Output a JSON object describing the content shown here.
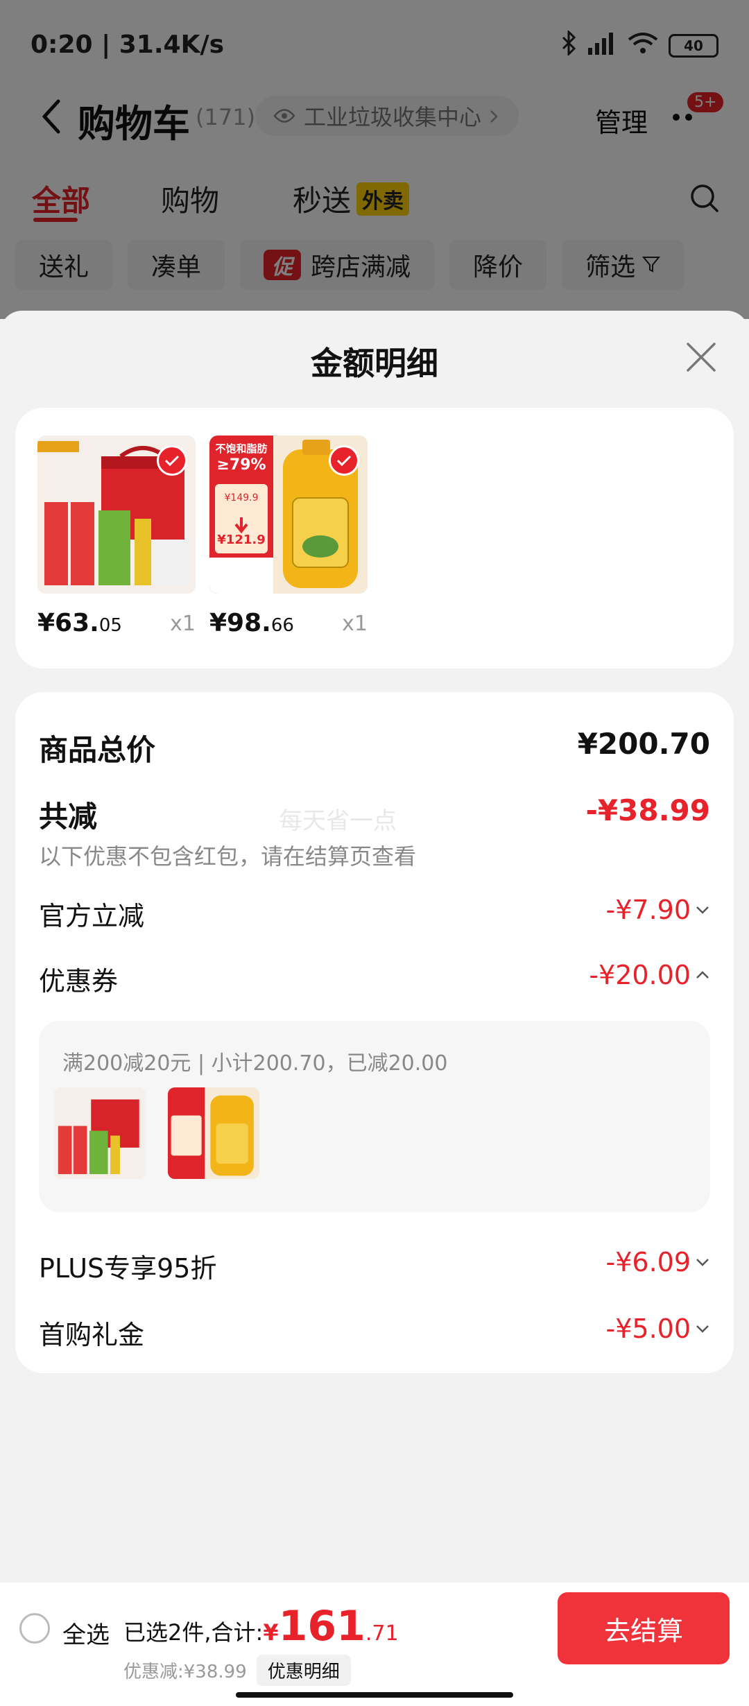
{
  "status_bar": {
    "time": "0:20 | 31.4K/s",
    "battery": "40"
  },
  "header": {
    "title": "购物车",
    "count": "(171)",
    "location": "工业垃圾收集中心",
    "manage_label": "管理",
    "badge": "5+"
  },
  "tabs": [
    {
      "label": "全部"
    },
    {
      "label": "购物"
    },
    {
      "label": "秒送",
      "tag": "外卖"
    }
  ],
  "filters": [
    {
      "label": "送礼"
    },
    {
      "label": "凑单"
    },
    {
      "tag": "促",
      "label": "跨店满减"
    },
    {
      "label": "降价"
    },
    {
      "label": "筛选"
    }
  ],
  "sheet": {
    "title": "金额明细",
    "products": [
      {
        "price_int": "¥63.",
        "price_dec": "05",
        "qty": "x1"
      },
      {
        "price_int": "¥98.",
        "price_dec": "66",
        "qty": "x1",
        "img_text_1": "不饱和脂肪",
        "img_text_2": "≥79%",
        "img_text_3": "¥149.9",
        "img_text_4": "¥121.9"
      }
    ],
    "total_label": "商品总价",
    "total_value": "¥200.70",
    "reduce_label": "共减",
    "reduce_value": "-¥38.99",
    "reduce_note": "以下优惠不包含红包，请在结算页查看",
    "watermark": "每天省一点",
    "discounts": [
      {
        "label": "官方立减",
        "value": "-¥7.90",
        "expanded": false
      },
      {
        "label": "优惠券",
        "value": "-¥20.00",
        "expanded": true
      },
      {
        "label": "PLUS专享95折",
        "value": "-¥6.09",
        "expanded": false
      },
      {
        "label": "首购礼金",
        "value": "-¥5.00",
        "expanded": false
      }
    ],
    "coupon_detail": "满200减20元 | 小计200.70，已减20.00"
  },
  "bottom_bar": {
    "select_all_label": "全选",
    "summary_prefix": "已选2件,合计:",
    "currency": "¥",
    "total_int": "161",
    "total_dec": ".71",
    "discount_line": "优惠减:¥38.99",
    "detail_label": "优惠明细",
    "checkout_label": "去结算"
  },
  "colors": {
    "accent": "#e8222b",
    "checkout": "#f0323a",
    "takeout_tag": "#ffd200"
  }
}
